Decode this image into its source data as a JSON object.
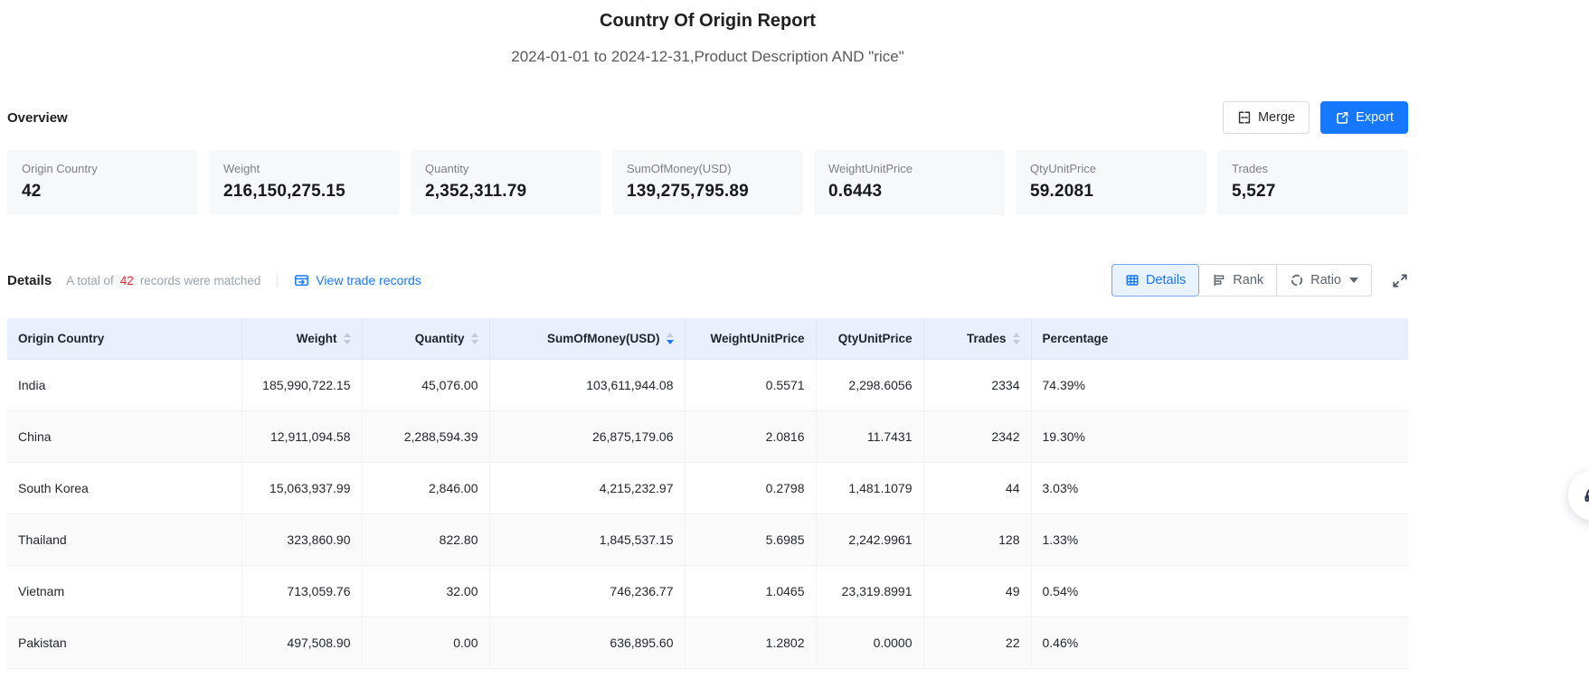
{
  "page": {
    "title": "Country Of Origin Report",
    "subtitle": "2024-01-01 to 2024-12-31,Product Description AND \"rice\""
  },
  "overview": {
    "heading": "Overview",
    "merge_label": "Merge",
    "export_label": "Export",
    "cards": [
      {
        "label": "Origin Country",
        "value": "42"
      },
      {
        "label": "Weight",
        "value": "216,150,275.15"
      },
      {
        "label": "Quantity",
        "value": "2,352,311.79"
      },
      {
        "label": "SumOfMoney(USD)",
        "value": "139,275,795.89"
      },
      {
        "label": "WeightUnitPrice",
        "value": "0.6443"
      },
      {
        "label": "QtyUnitPrice",
        "value": "59.2081"
      },
      {
        "label": "Trades",
        "value": "5,527"
      }
    ]
  },
  "details": {
    "heading": "Details",
    "total_prefix": "A total of",
    "total_count": "42",
    "total_suffix": "records were matched",
    "view_trade_link": "View trade records",
    "tabs": {
      "details": "Details",
      "rank": "Rank",
      "ratio": "Ratio"
    }
  },
  "table": {
    "columns": [
      {
        "label": "Origin Country",
        "align": "left",
        "sortable": false
      },
      {
        "label": "Weight",
        "align": "right",
        "sortable": true
      },
      {
        "label": "Quantity",
        "align": "right",
        "sortable": true
      },
      {
        "label": "SumOfMoney(USD)",
        "align": "right",
        "sortable": true,
        "sort": "desc"
      },
      {
        "label": "WeightUnitPrice",
        "align": "right",
        "sortable": false
      },
      {
        "label": "QtyUnitPrice",
        "align": "right",
        "sortable": false
      },
      {
        "label": "Trades",
        "align": "right",
        "sortable": true
      },
      {
        "label": "Percentage",
        "align": "left",
        "sortable": false
      }
    ],
    "rows": [
      {
        "cells": [
          "India",
          "185,990,722.15",
          "45,076.00",
          "103,611,944.08",
          "0.5571",
          "2,298.6056",
          "2334",
          "74.39%"
        ]
      },
      {
        "cells": [
          "China",
          "12,911,094.58",
          "2,288,594.39",
          "26,875,179.06",
          "2.0816",
          "11.7431",
          "2342",
          "19.30%"
        ]
      },
      {
        "cells": [
          "South Korea",
          "15,063,937.99",
          "2,846.00",
          "4,215,232.97",
          "0.2798",
          "1,481.1079",
          "44",
          "3.03%"
        ]
      },
      {
        "cells": [
          "Thailand",
          "323,860.90",
          "822.80",
          "1,845,537.15",
          "5.6985",
          "2,242.9961",
          "128",
          "1.33%"
        ]
      },
      {
        "cells": [
          "Vietnam",
          "713,059.76",
          "32.00",
          "746,236.77",
          "1.0465",
          "23,319.8991",
          "49",
          "0.54%"
        ]
      },
      {
        "cells": [
          "Pakistan",
          "497,508.90",
          "0.00",
          "636,895.60",
          "1.2802",
          "0.0000",
          "22",
          "0.46%"
        ]
      }
    ]
  },
  "colors": {
    "accent": "#1677ff",
    "danger": "#f5222d",
    "table_header_bg": "#e9f0fc",
    "card_bg": "#f7f8fa"
  }
}
